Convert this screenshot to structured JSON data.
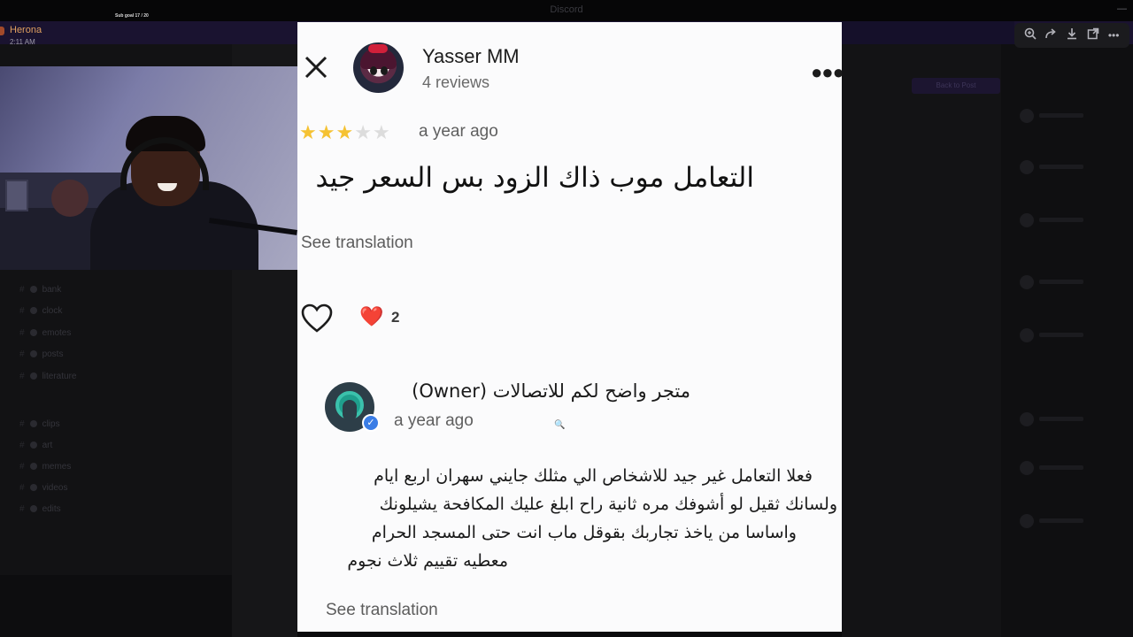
{
  "stream": {
    "sub_goal": "Sub goal 17 / 20",
    "server_owner_name": "Herona",
    "server_owner_time": "2:11 AM"
  },
  "background": {
    "window_title": "Discord",
    "channels": [
      "bank",
      "clock",
      "emotes",
      "posts",
      "literature",
      "clips",
      "art",
      "memes",
      "videos",
      "edits"
    ],
    "button_label": "Back to Post"
  },
  "viewer_toolbar": {
    "icons": [
      "zoom-icon",
      "share-icon",
      "download-icon",
      "open-external-icon",
      "more-icon"
    ]
  },
  "review": {
    "user_name": "Yasser MM",
    "user_reviews": "4 reviews",
    "rating": 3,
    "max_rating": 5,
    "time": "a year ago",
    "text": "التعامل موب ذاك الزود بس السعر جيد",
    "see_translation": "See translation",
    "reaction_emoji": "❤️",
    "reaction_count": "2",
    "colors": {
      "star_on": "#f5c233",
      "star_off": "#dcdcdc",
      "reaction": "#d0143a"
    }
  },
  "owner_reply": {
    "name": "متجر واضح لكم للاتصالات (Owner)",
    "time": "a year ago",
    "lines": [
      "فعلا التعامل غير جيد للاشخاص الي مثلك جايني سهران اربع ايام",
      "ولسانك ثقيل لو أشوفك مره ثانية راح ابلغ عليك المكافحة يشيلونك",
      "واساسا من ياخذ تجاربك بقوقل ماب انت حتى المسجد الحرام",
      "معطيه تقييم ثلاث نجوم"
    ],
    "see_translation": "See translation"
  }
}
